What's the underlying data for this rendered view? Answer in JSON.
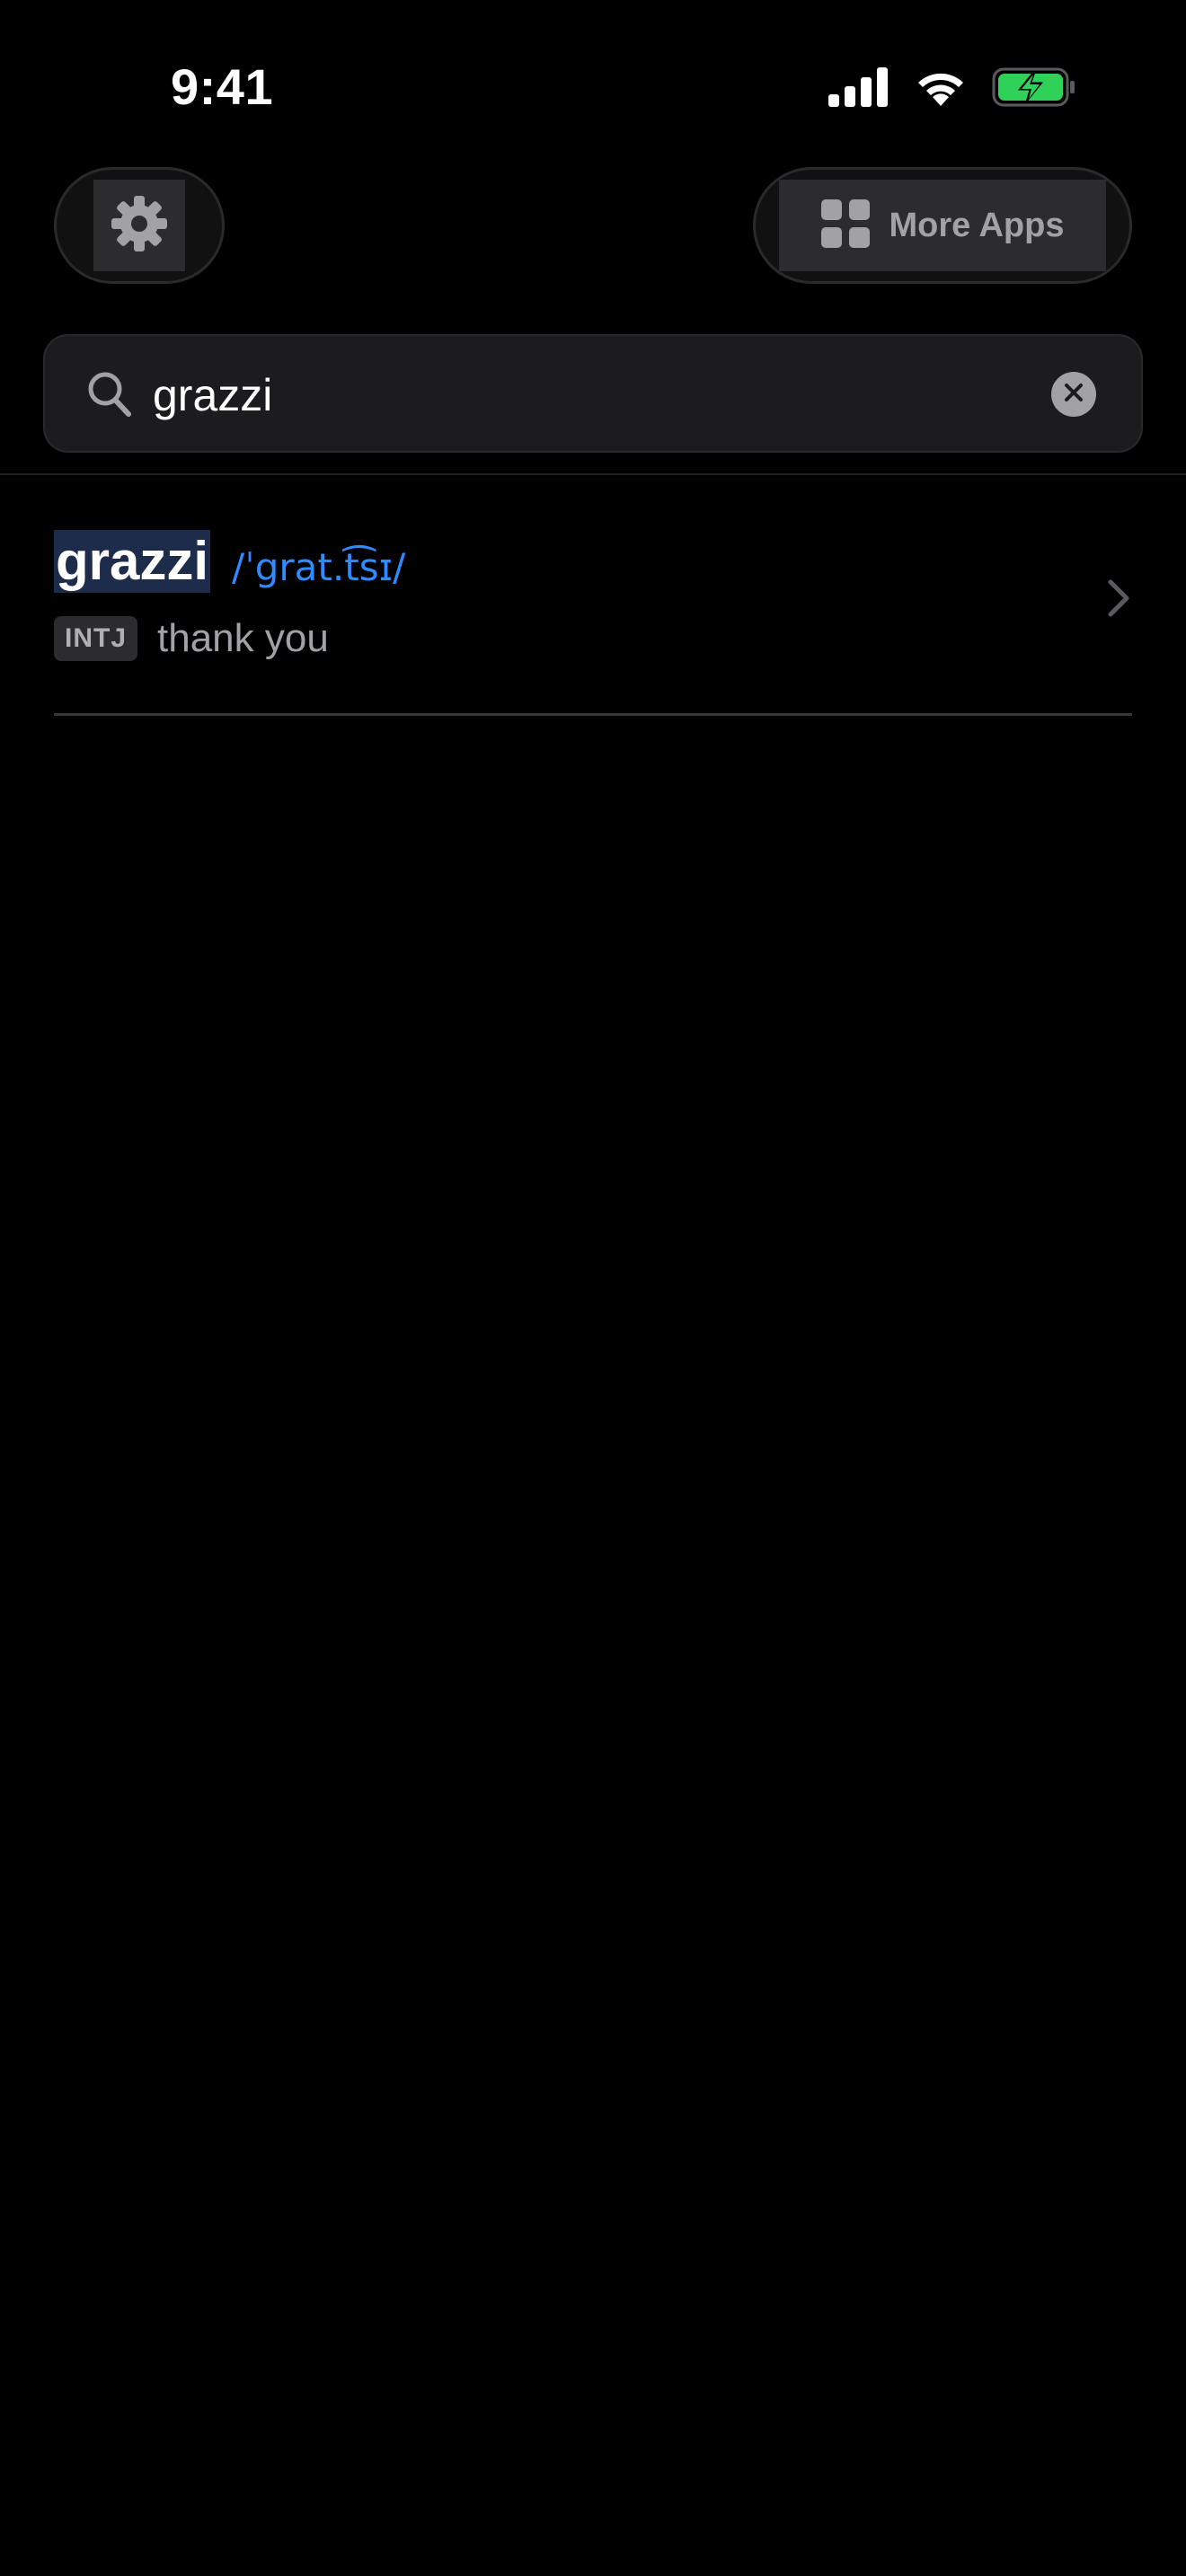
{
  "status_bar": {
    "time": "9:41",
    "battery_color": "#30d158",
    "icons": [
      "cellular-signal-icon",
      "wifi-icon",
      "battery-charging-icon"
    ]
  },
  "toolbar": {
    "settings_icon": "gear-icon",
    "more_apps_label": "More Apps",
    "more_apps_icon": "app-grid-icon"
  },
  "search": {
    "value": "grazzi",
    "placeholder": "",
    "icon": "search-icon",
    "clear_icon": "clear-icon"
  },
  "results": [
    {
      "word": "grazzi",
      "pronunciation": "/ˈgrat.t͡sɪ/",
      "part_of_speech": "INTJ",
      "definition": "thank you",
      "chevron_icon": "chevron-right-icon"
    }
  ],
  "colors": {
    "background": "#000000",
    "accent": "#2f8bff",
    "highlight": "#1c2c4a",
    "secondary_text": "#a1a1a6"
  }
}
